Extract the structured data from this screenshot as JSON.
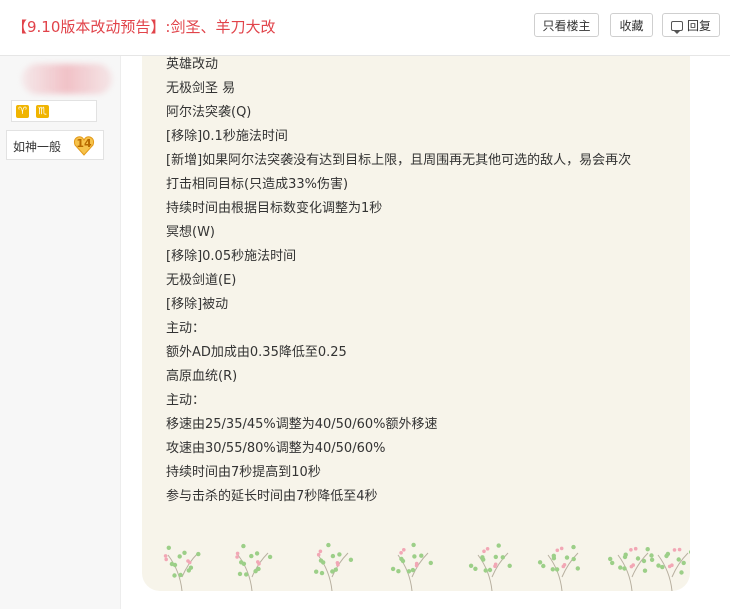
{
  "header": {
    "title": "【9.10版本改动预告】:剑圣、羊刀大改",
    "buttons": {
      "only_op": "只看楼主",
      "favorite": "收藏",
      "reply": "回复"
    }
  },
  "sidebar": {
    "level_name": "如神一般",
    "level_number": "14",
    "zodiac_icons": [
      "zodiac-icon",
      "zodiac-icon"
    ]
  },
  "post": {
    "lines": [
      "英雄改动",
      "无极剑圣 易",
      "阿尔法突袭(Q)",
      "[移除]0.1秒施法时间",
      "[新增]如果阿尔法突袭没有达到目标上限，且周围再无其他可选的敌人，易会再次",
      "打击相同目标(只造成33%伤害)",
      "持续时间由根据目标数变化调整为1秒",
      "冥想(W)",
      "[移除]0.05秒施法时间",
      "无极剑道(E)",
      "[移除]被动",
      "主动：",
      "额外AD加成由0.35降低至0.25",
      "高原血统(R)",
      "主动：",
      "移速由25/35/45%调整为40/50/60%额外移速",
      "攻速由30/55/80%调整为40/50/60%",
      "持续时间由7秒提高到10秒",
      "参与击杀的延长时间由7秒降低至4秒"
    ]
  },
  "colors": {
    "title_red": "#e1434a",
    "post_bg": "#f7f4ea",
    "sidebar_bg": "#f7f7f7",
    "badge_gold": "#f0b400"
  }
}
